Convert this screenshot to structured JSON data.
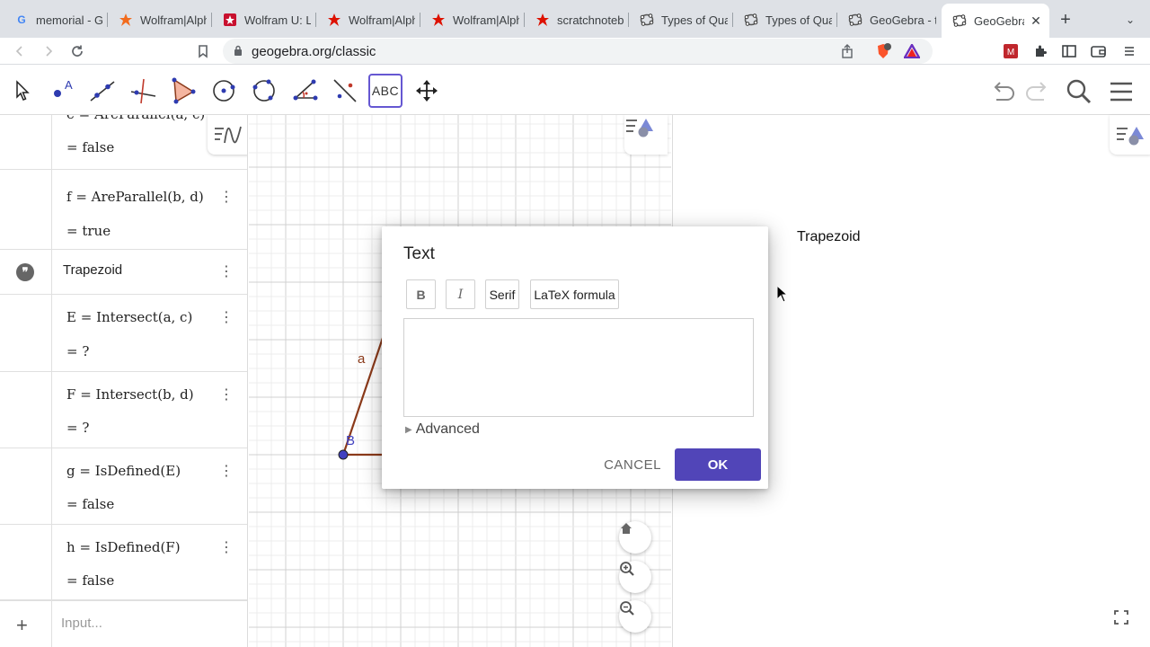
{
  "browser": {
    "tabs": [
      {
        "icon": "google-icon",
        "title": "memorial - Go"
      },
      {
        "icon": "wolfram-icon",
        "title": "Wolfram|Alpha"
      },
      {
        "icon": "wolfram-u-icon",
        "title": "Wolfram U: Le"
      },
      {
        "icon": "wolfram-icon",
        "title": "Wolfram|Alpha"
      },
      {
        "icon": "wolfram-icon",
        "title": "Wolfram|Alpha"
      },
      {
        "icon": "wolfram-icon",
        "title": "scratchnotebo"
      },
      {
        "icon": "geogebra-icon",
        "title": "Types of Quad"
      },
      {
        "icon": "geogebra-icon",
        "title": "Types of Quad"
      },
      {
        "icon": "geogebra-icon",
        "title": "GeoGebra - th"
      },
      {
        "icon": "geogebra-icon",
        "title": "GeoGebra"
      }
    ],
    "url": "geogebra.org/classic",
    "brave_badge": "3"
  },
  "toolbar": {
    "tools": [
      "move-tool",
      "point-tool",
      "line-tool",
      "perpendicular-tool",
      "polygon-tool",
      "circle-tool",
      "ellipse-tool",
      "angle-tool",
      "reflect-tool",
      "text-tool",
      "move-graphics-tool"
    ],
    "text_tool_label": "ABC"
  },
  "algebra": {
    "rows": [
      {
        "name": "e",
        "def": "AreParallel(a, c)",
        "value": "false"
      },
      {
        "name": "f",
        "def": "AreParallel(b, d)",
        "value": "true"
      },
      {
        "text": "Trapezoid"
      },
      {
        "name": "E",
        "def": "Intersect(a, c)",
        "value": "?"
      },
      {
        "name": "F",
        "def": "Intersect(b, d)",
        "value": "?"
      },
      {
        "name": "g",
        "def": "IsDefined(E)",
        "value": "false"
      },
      {
        "name": "h",
        "def": "IsDefined(F)",
        "value": "false"
      }
    ],
    "input_placeholder": "Input..."
  },
  "graphics": {
    "labels": {
      "segment": "a",
      "point": "B"
    },
    "colors": {
      "segment": "#8b3a1a",
      "point": "#4040c0",
      "grid_major": "#d0d0d0",
      "grid_minor": "#ececec"
    }
  },
  "graphics2": {
    "text": "Trapezoid"
  },
  "dialog": {
    "title": "Text",
    "bold": "B",
    "italic": "I",
    "serif": "Serif",
    "latex": "LaTeX formula",
    "advanced": "Advanced",
    "cancel": "CANCEL",
    "ok": "OK",
    "accent": "#5145b8"
  }
}
